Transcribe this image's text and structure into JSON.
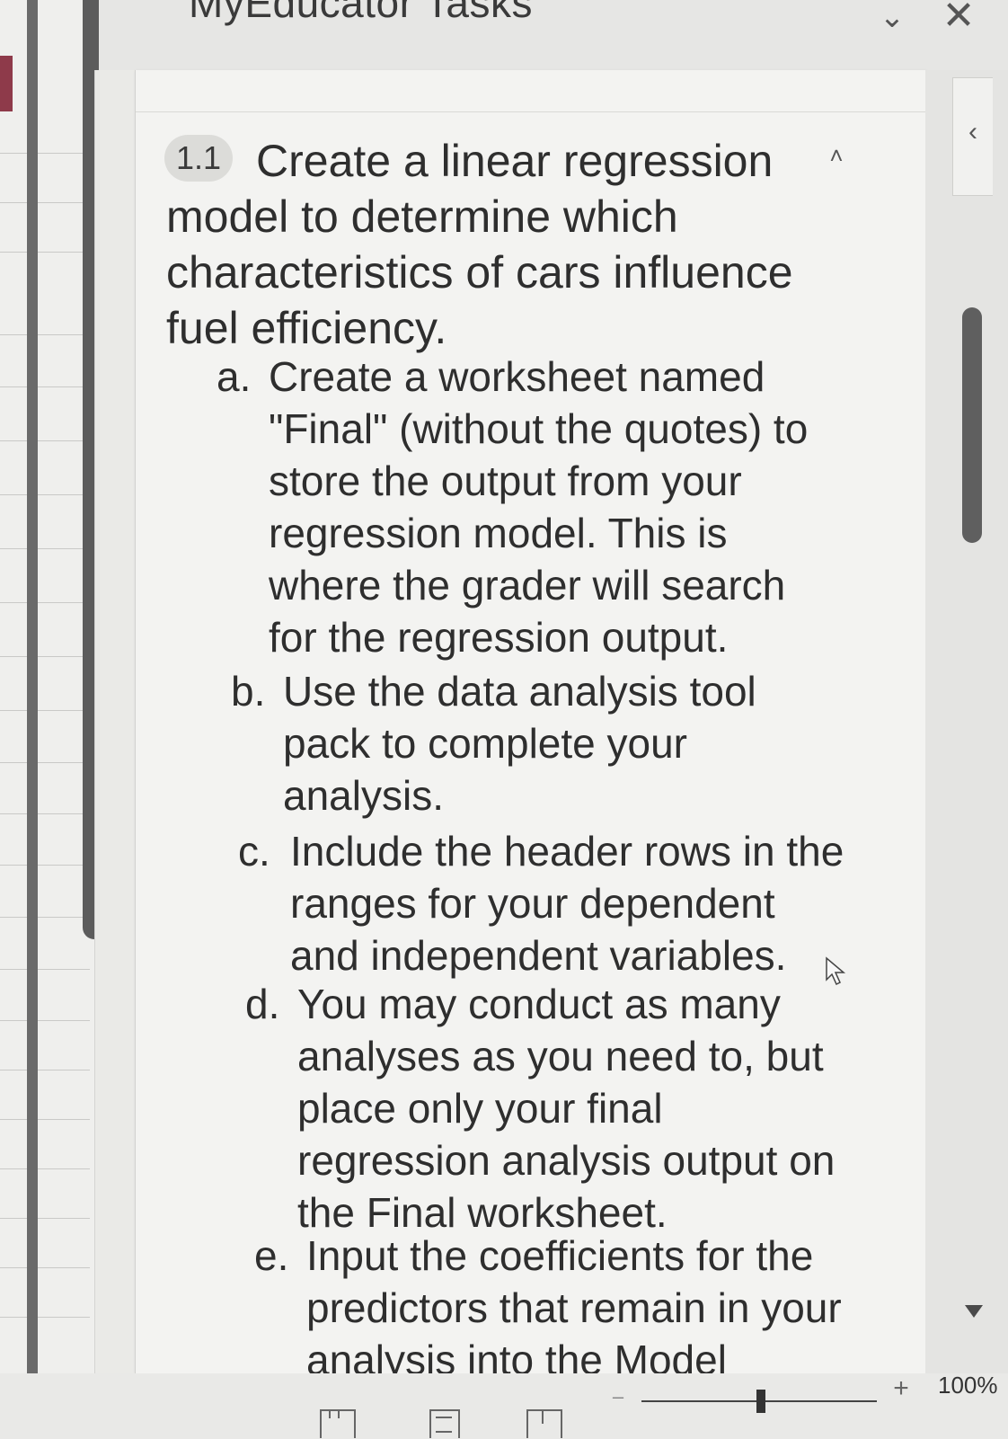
{
  "pane": {
    "title": "MyEducator Tasks",
    "dropdown_icon": "chevron-down-icon",
    "close_icon": "close-icon",
    "collapse_side_icon": "chevron-left-icon"
  },
  "task": {
    "number": "1.1",
    "title": "Create a linear regression model to determine which characteristics of cars influence fuel efficiency.",
    "collapse_icon": "chevron-up-icon",
    "subtasks": [
      {
        "marker": "a.",
        "lines": [
          "Create a worksheet named",
          "\"Final\" (without the quotes) to",
          "store the output from your",
          "regression model. This is",
          "where the grader will search",
          "for the regression output."
        ]
      },
      {
        "marker": "b.",
        "lines": [
          "Use the data analysis tool",
          "pack to complete your",
          "analysis."
        ]
      },
      {
        "marker": "c.",
        "lines": [
          "Include the header rows in the",
          "ranges for your dependent",
          "and independent variables."
        ]
      },
      {
        "marker": "d.",
        "lines": [
          "You may conduct as many",
          "analyses as you need to, but",
          "place only your final",
          "regression analysis output on",
          "the Final worksheet."
        ]
      },
      {
        "marker": "e.",
        "lines": [
          "Input the coefficients for the",
          "predictors that remain in your",
          "analysis into the Model"
        ]
      }
    ]
  },
  "status_bar": {
    "zoom_minus": "–",
    "zoom_plus": "+",
    "zoom_level": "100%",
    "zoom_fraction": 0.5
  }
}
